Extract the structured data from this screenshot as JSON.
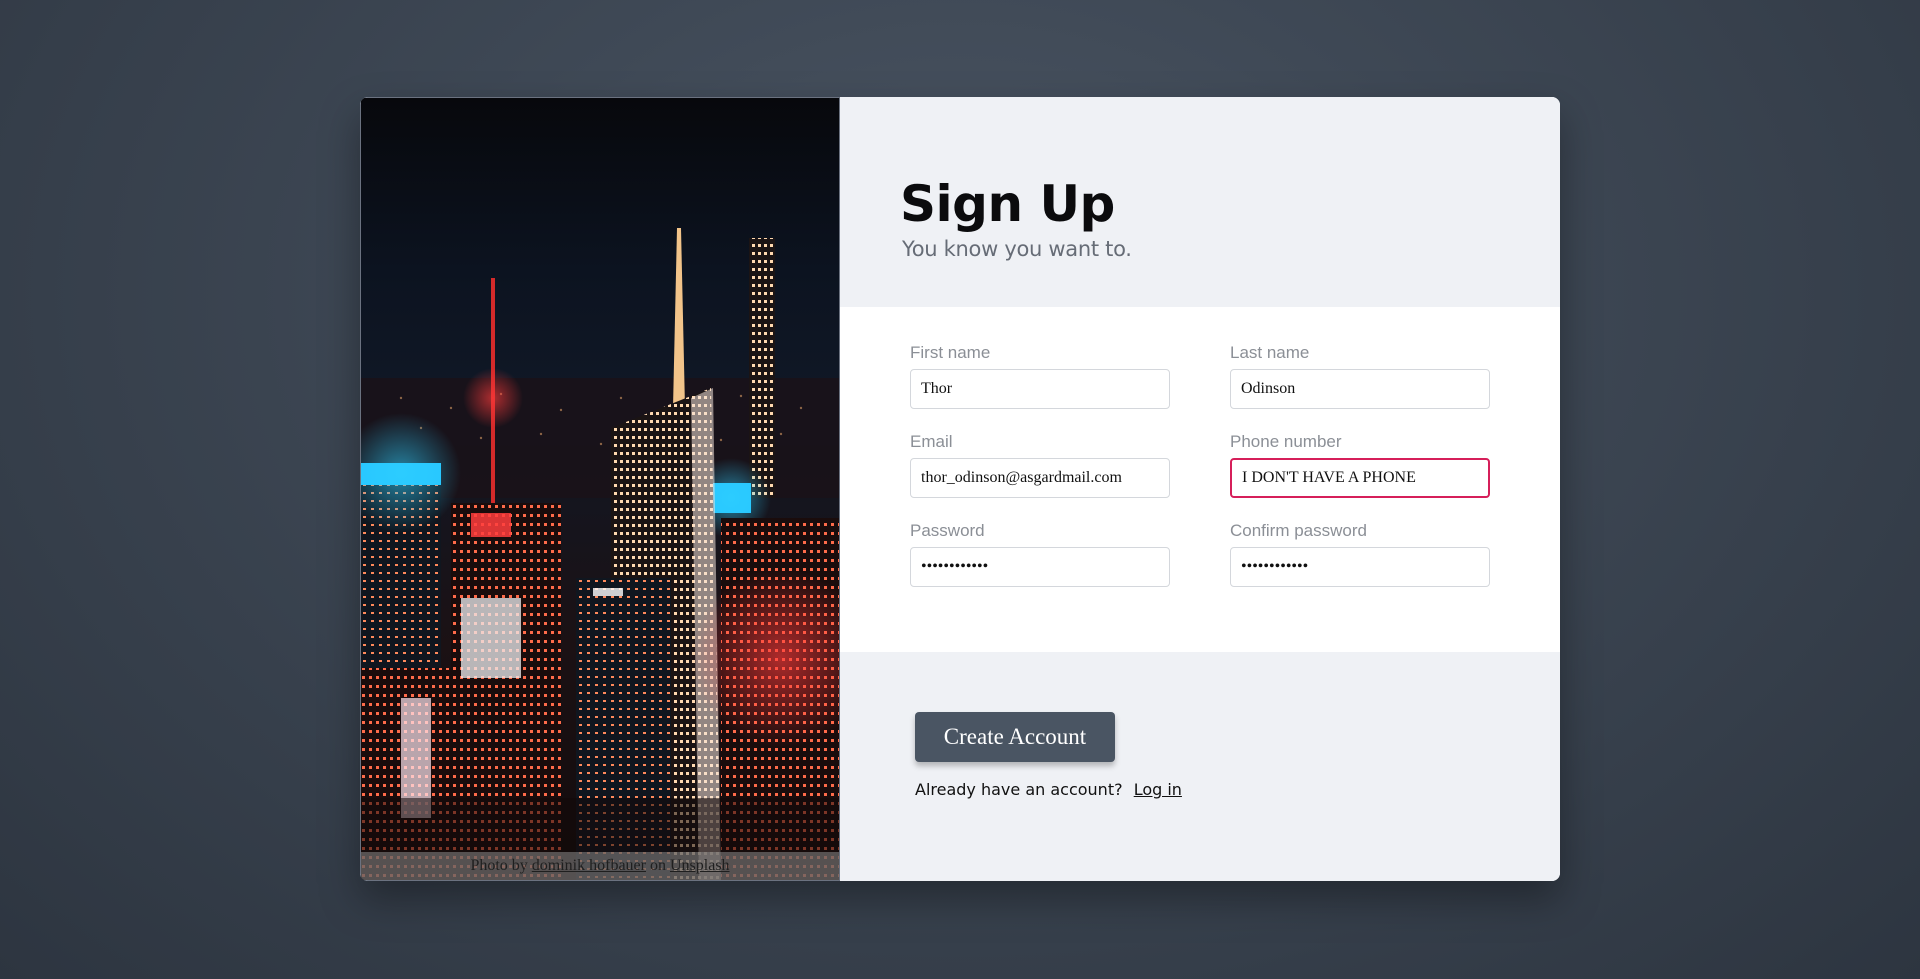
{
  "signup": {
    "title": "Sign Up",
    "subtitle": "You know you want to."
  },
  "photo": {
    "alt": "Night city skyline",
    "credit_prefix": "Photo by",
    "credit_author": "dominik hofbauer",
    "credit_middle": "on",
    "credit_source": "Unsplash"
  },
  "fields": {
    "first_name": {
      "label": "First name",
      "value": "Thor"
    },
    "last_name": {
      "label": "Last name",
      "value": "Odinson"
    },
    "email": {
      "label": "Email",
      "value": "thor_odinson@asgardmail.com"
    },
    "phone": {
      "label": "Phone number",
      "value": "I DON'T HAVE A PHONE",
      "state": "invalid"
    },
    "password": {
      "label": "Password",
      "value": "••••••••••••"
    },
    "confirm_password": {
      "label": "Confirm password",
      "value": "••••••••••••"
    }
  },
  "actions": {
    "create_account_label": "Create Account",
    "login_prompt": "Already have an account?",
    "login_link": "Log in"
  },
  "colors": {
    "background": "#3f4956",
    "button": "#4a5563",
    "invalid_border": "#d61f5a",
    "panel": "#eff1f5"
  }
}
